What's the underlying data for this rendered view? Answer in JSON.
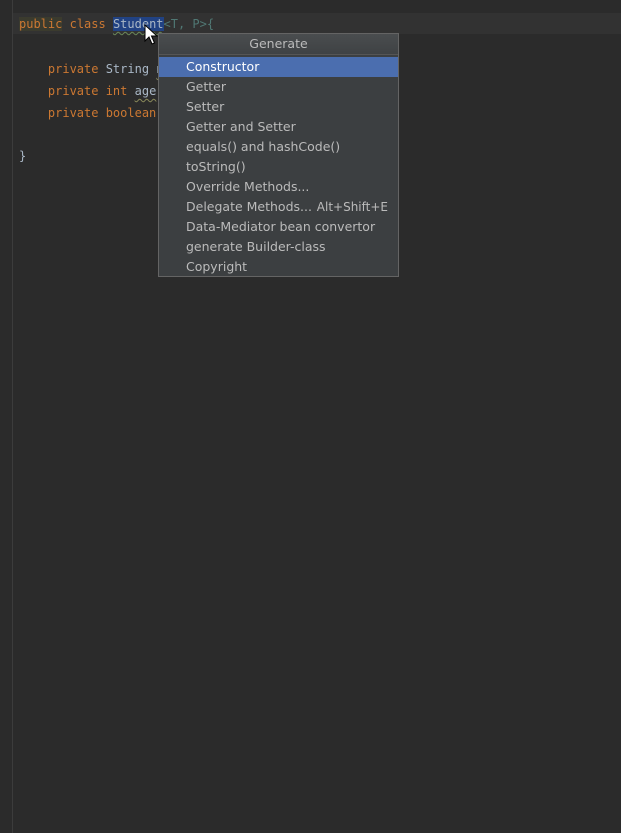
{
  "code": {
    "line1": {
      "public": "public",
      "space1": " ",
      "class": "class",
      "space2": " ",
      "class_name": "Student",
      "generics": "<T, P>{"
    },
    "line2": {
      "indent": "    ",
      "private": "private",
      "type": " String ",
      "name_fragment": "n"
    },
    "line3": {
      "indent": "    ",
      "private": "private",
      "type": " int",
      "space": " ",
      "name": "age",
      "tail": ";"
    },
    "line4": {
      "indent": "    ",
      "private": "private",
      "type": " boolean"
    },
    "line5": {
      "brace": "}"
    }
  },
  "popup": {
    "title": "Generate",
    "items": [
      {
        "label": "Constructor",
        "shortcut": ""
      },
      {
        "label": "Getter",
        "shortcut": ""
      },
      {
        "label": "Setter",
        "shortcut": ""
      },
      {
        "label": "Getter and Setter",
        "shortcut": ""
      },
      {
        "label": "equals() and hashCode()",
        "shortcut": ""
      },
      {
        "label": "toString()",
        "shortcut": ""
      },
      {
        "label": "Override Methods...",
        "shortcut": ""
      },
      {
        "label": "Delegate Methods...",
        "shortcut": "Alt+Shift+E"
      },
      {
        "label": "Data-Mediator bean convertor",
        "shortcut": ""
      },
      {
        "label": "generate Builder-class",
        "shortcut": ""
      },
      {
        "label": "Copyright",
        "shortcut": ""
      }
    ],
    "selected_index": 0
  },
  "colors": {
    "background": "#2b2b2b",
    "keyword": "#cc7832",
    "text": "#a9b7c6",
    "selection": "#214283",
    "popup_bg": "#3c3f41",
    "popup_selected": "#4b6eaf"
  }
}
